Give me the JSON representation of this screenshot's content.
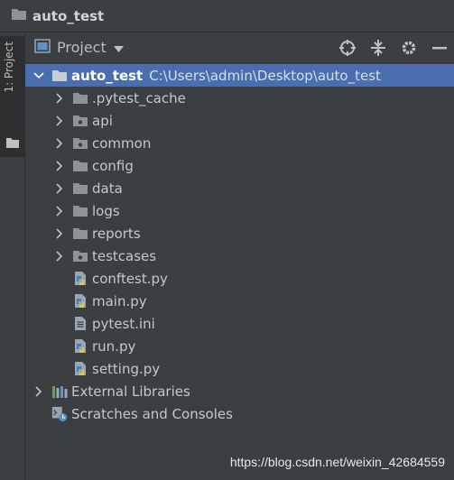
{
  "window": {
    "title": "auto_test"
  },
  "sidebar": {
    "tab_label": "1: Project"
  },
  "toolbar": {
    "view_label": "Project",
    "tools": [
      "locate-icon",
      "collapse-icon",
      "gear-icon",
      "minimize-icon"
    ]
  },
  "tree": {
    "root": {
      "name": "auto_test",
      "path": "C:\\Users\\admin\\Desktop\\auto_test"
    },
    "folders": [
      {
        "name": ".pytest_cache",
        "kind": "folder"
      },
      {
        "name": "api",
        "kind": "package"
      },
      {
        "name": "common",
        "kind": "package"
      },
      {
        "name": "config",
        "kind": "folder"
      },
      {
        "name": "data",
        "kind": "folder"
      },
      {
        "name": "logs",
        "kind": "folder"
      },
      {
        "name": "reports",
        "kind": "folder"
      },
      {
        "name": "testcases",
        "kind": "package"
      }
    ],
    "files": [
      {
        "name": "conftest.py",
        "kind": "python"
      },
      {
        "name": "main.py",
        "kind": "python"
      },
      {
        "name": "pytest.ini",
        "kind": "text"
      },
      {
        "name": "run.py",
        "kind": "python"
      },
      {
        "name": "setting.py",
        "kind": "python"
      }
    ],
    "external_libraries": "External Libraries",
    "scratches": "Scratches and Consoles"
  },
  "watermark": "https://blog.csdn.net/weixin_42684559",
  "colors": {
    "background": "#3c3f41",
    "selection": "#4b6eaf",
    "folder": "#8e9399",
    "python_blue": "#3f7fc0",
    "python_yellow": "#e1c83f"
  }
}
